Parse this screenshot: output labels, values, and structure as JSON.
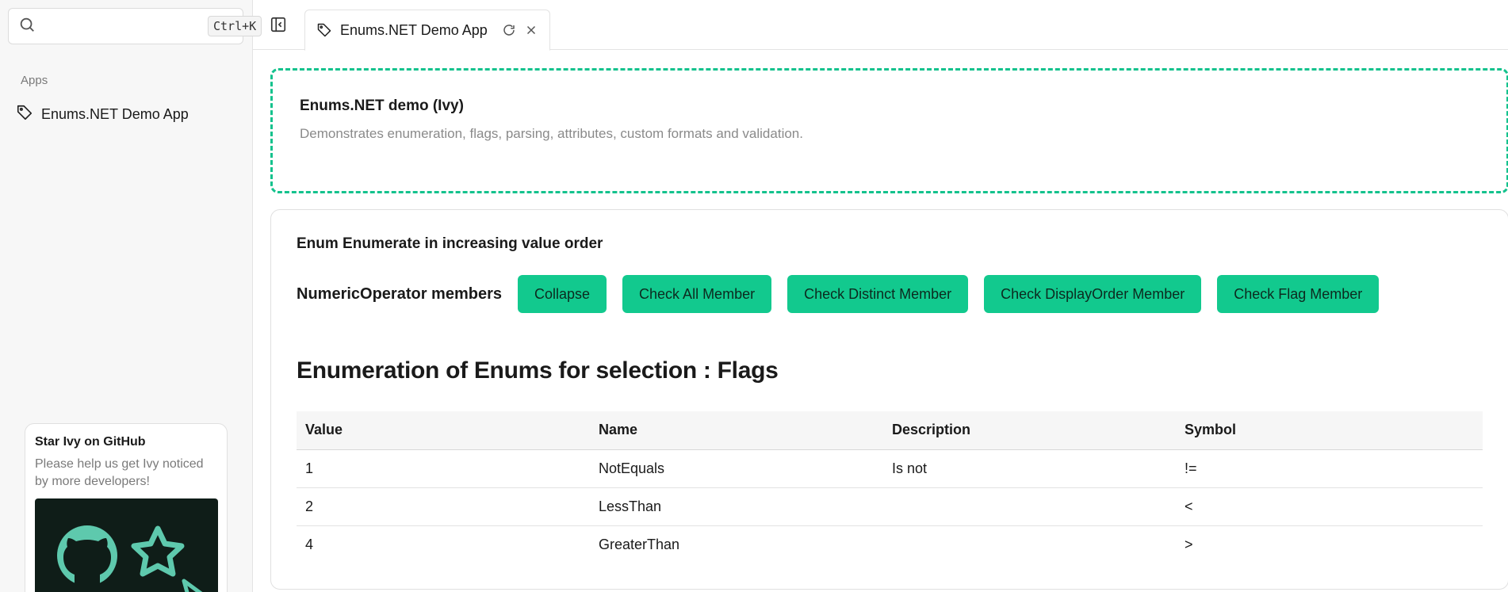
{
  "sidebar": {
    "search": {
      "placeholder": "",
      "shortcut": "Ctrl+K"
    },
    "section_label": "Apps",
    "items": [
      {
        "label": "Enums.NET Demo App",
        "icon": "tag-icon"
      }
    ],
    "promo": {
      "title": "Star Ivy on GitHub",
      "text": "Please help us get Ivy noticed by more developers!"
    }
  },
  "tabbar": {
    "tab": {
      "label": "Enums.NET Demo App",
      "icon": "tag-icon"
    }
  },
  "intro": {
    "title": "Enums.NET demo (Ivy)",
    "description": "Demonstrates enumeration, flags, parsing, attributes, custom formats and validation."
  },
  "panel": {
    "subheading": "Enum Enumerate in increasing value order",
    "row_label": "NumericOperator members",
    "buttons": [
      "Collapse",
      "Check All Member",
      "Check Distinct Member",
      "Check DisplayOrder Member",
      "Check Flag Member"
    ],
    "heading": "Enumeration of Enums for selection : Flags",
    "table": {
      "headers": [
        "Value",
        "Name",
        "Description",
        "Symbol"
      ],
      "rows": [
        [
          "1",
          "NotEquals",
          "Is not",
          "!="
        ],
        [
          "2",
          "LessThan",
          "",
          "<"
        ],
        [
          "4",
          "GreaterThan",
          "",
          ">"
        ]
      ]
    }
  },
  "colors": {
    "accent": "#12c98e",
    "dashed_border": "#14c28d",
    "promo_bg": "#0f1d18",
    "github_green": "#5ec9ad"
  }
}
